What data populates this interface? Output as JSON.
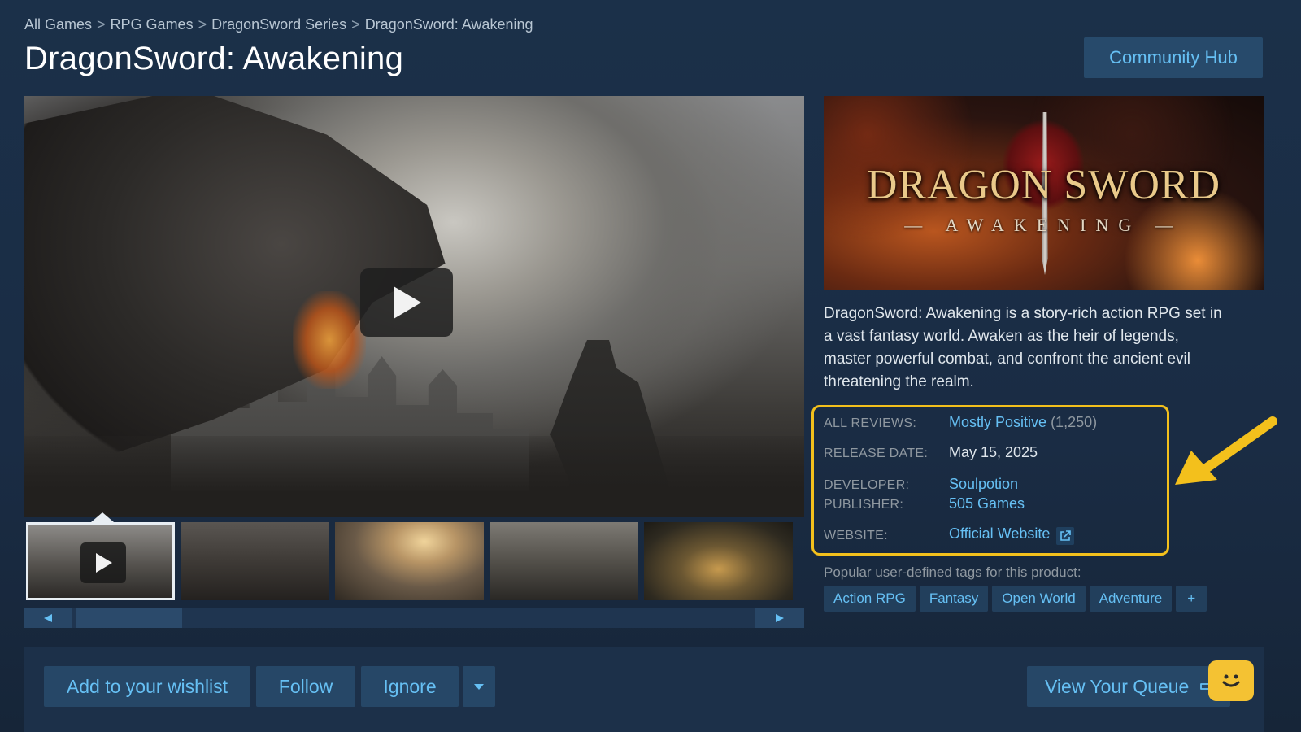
{
  "breadcrumb": {
    "items": [
      "All Games",
      "RPG Games",
      "DragonSword Series",
      "DragonSword: Awakening"
    ],
    "separator": ">"
  },
  "page": {
    "title": "DragonSword: Awakening",
    "community_hub_label": "Community Hub"
  },
  "capsule": {
    "logo_title": "DRAGON SWORD",
    "logo_subtitle": "— AWAKENING —"
  },
  "description": "DragonSword: Awakening is a story-rich action RPG set in a vast fantasy world. Awaken as the heir of legends, master powerful combat, and confront the ancient evil threatening the realm.",
  "info": {
    "reviews_label": "ALL REVIEWS:",
    "reviews_value": "Mostly Positive",
    "reviews_count": "(1,250)",
    "release_label": "RELEASE DATE:",
    "release_value": "May 15, 2025",
    "developer_label": "DEVELOPER:",
    "developer_value": "Soulpotion",
    "publisher_label": "PUBLISHER:",
    "publisher_value": "505 Games",
    "website_label": "WEBSITE:",
    "website_value": "Official Website"
  },
  "tags": {
    "label": "Popular user-defined tags for this product:",
    "items": [
      "Action RPG",
      "Fantasy",
      "Open World",
      "Adventure"
    ],
    "more": "+"
  },
  "actions": {
    "wishlist": "Add to your wishlist",
    "follow": "Follow",
    "ignore": "Ignore",
    "queue": "View Your Queue"
  },
  "icons": {
    "play": "play-icon",
    "external_link": "external-link-icon",
    "dropdown": "chevron-down-icon",
    "queue_arrow": "arrow-right-icon",
    "assistant": "smiley-icon",
    "annotation_arrow": "annotation-arrow-icon"
  },
  "colors": {
    "accent_link": "#66c0f4",
    "annotation_highlight": "#f3c01c",
    "button_bg": "#264767",
    "page_bg": "#1b3049"
  }
}
